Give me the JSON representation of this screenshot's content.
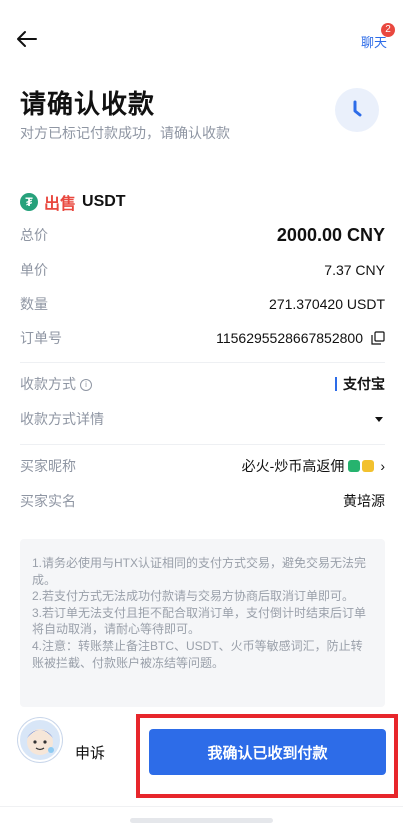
{
  "header": {
    "chat_label": "聊天",
    "chat_badge": "2",
    "title": "请确认收款",
    "subtitle": "对方已标记付款成功，请确认收款"
  },
  "order": {
    "side": "出售",
    "coin": "USDT",
    "total_label": "总价",
    "total_value": "2000.00 CNY",
    "price_label": "单价",
    "price_value": "7.37 CNY",
    "qty_label": "数量",
    "qty_value": "271.370420 USDT",
    "order_no_label": "订单号",
    "order_no_value": "1156295528667852800"
  },
  "payment": {
    "method_label": "收款方式",
    "method_value": "支付宝",
    "details_label": "收款方式详情"
  },
  "buyer": {
    "nickname_label": "买家昵称",
    "nickname_value": "必火-炒币高返佣",
    "realname_label": "买家实名",
    "realname_value": "黄培源"
  },
  "notice": [
    "1.请务必使用与HTX认证相同的支付方式交易，避免交易无法完成。",
    "2.若支付方式无法成功付款请与交易方协商后取消订单即可。",
    "3.若订单无法支付且拒不配合取消订单，支付倒计时结束后订单将自动取消，请耐心等待即可。",
    "4.注意：转账禁止备注BTC、USDT、火币等敏感词汇，防止转账被拦截、付款账户被冻结等问题。"
  ],
  "actions": {
    "appeal_label": "申诉",
    "confirm_label": "我确认已收到付款"
  },
  "colors": {
    "accent": "#2d6ce8",
    "sell": "#e9483f",
    "highlight_frame": "#e7262b",
    "tether": "#26a17b"
  },
  "icons": [
    "back-arrow-icon",
    "clock-icon",
    "tether-icon",
    "copy-icon",
    "info-icon",
    "dropdown-triangle-icon",
    "chevron-right-icon"
  ]
}
